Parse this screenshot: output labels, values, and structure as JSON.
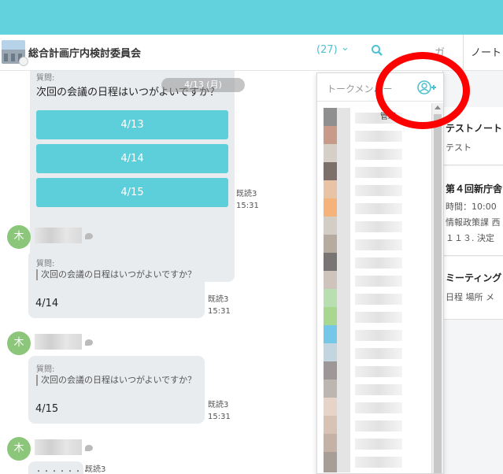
{
  "header": {
    "room_name": "総合計画庁内検討委員会",
    "member_count": "(27)",
    "member_chevron": "⌄",
    "tab_partial": "ガ",
    "tab_note": "ノート"
  },
  "chat": {
    "date_pill": "4/13 (月)",
    "first_question": {
      "label": "質問:",
      "text": "次回の会議の日程はいつがよいですか？",
      "options": [
        "4/13",
        "4/14",
        "4/15"
      ],
      "read": "既読3",
      "time": "15:31"
    },
    "replies": [
      {
        "avatar": "木",
        "label": "質問:",
        "quote": "次回の会議の日程はいつがよいですか？",
        "answer": "4/14",
        "read": "既読3",
        "time": "15:31"
      },
      {
        "avatar": "木",
        "label": "質問:",
        "quote": "次回の会議の日程はいつがよいですか？",
        "answer": "4/15",
        "read": "既読3",
        "time": "15:31"
      },
      {
        "avatar": "木",
        "answer": "・・・・・・・",
        "read": "既読3"
      }
    ]
  },
  "member_dropdown": {
    "title": "トークメンバー",
    "first_member_sub": "管理",
    "row_colors": [
      "#8f8f8f",
      "#c79a8a",
      "#d6cfc8",
      "#7d6f6a",
      "#e8c3a6",
      "#f5b37a",
      "#d3cdc6",
      "#b7aba0",
      "#7a7575",
      "#cfc4bb",
      "#b9dfb0",
      "#a8d88f",
      "#74c7e7",
      "#c3d6e0",
      "#9e9797",
      "#bdb5b0",
      "#e7d4c8",
      "#d8c2b4",
      "#c5b2a6",
      "#a89e98"
    ]
  },
  "notes": [
    {
      "title": "テストノート",
      "lines": [
        "テスト"
      ]
    },
    {
      "title": "第４回新庁舎",
      "lines": [
        "時間：10:00",
        "情報政策課 西",
        "１１３. 決定"
      ]
    },
    {
      "title": "ミーティング",
      "lines": [
        "日程 場所 メ"
      ]
    }
  ],
  "colors": {
    "accent": "#5ccfdb",
    "topbar": "#62d2dc",
    "avatar": "#8bc67a",
    "annotation": "#ff0000"
  }
}
